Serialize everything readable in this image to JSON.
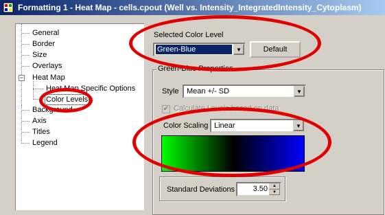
{
  "window": {
    "title": "Formatting 1 - Heat Map - cells.cpout (Well vs. Intensity_IntegratedIntensity_Cytoplasm)"
  },
  "tree": {
    "items": [
      "General",
      "Border",
      "Size",
      "Overlays",
      "Heat Map",
      "Heat Map Specific Options",
      "Color Levels",
      "Background",
      "Axis",
      "Titles",
      "Legend"
    ],
    "expander_symbol": "−"
  },
  "color_level": {
    "label": "Selected Color Level",
    "selected": "Green-Blue",
    "default_button": "Default"
  },
  "properties": {
    "title": "Green-Blue Properties",
    "style_label": "Style",
    "style_value": "Mean +/- SD",
    "calculate_label": "Calculate Levels based on data",
    "calculate_checked": true,
    "color_scaling_label": "Color Scaling",
    "color_scaling_value": "Linear",
    "std_dev_label": "Standard Deviations",
    "std_dev_value": "3.50"
  },
  "gradient_colors": [
    "#00ff00",
    "#000000",
    "#0000ff"
  ],
  "highlight_color": "#e00000"
}
